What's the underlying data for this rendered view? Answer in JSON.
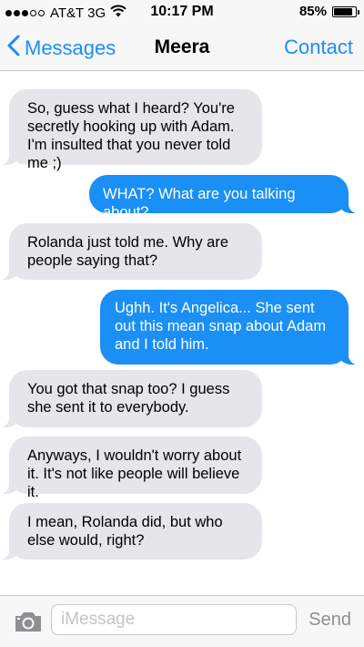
{
  "status_bar": {
    "carrier": "AT&T 3G",
    "time": "10:17 PM",
    "battery": "85%",
    "battery_level": 0.85,
    "signal_bars_filled": 3,
    "signal_bars_total": 5
  },
  "nav": {
    "back_label": "Messages",
    "title": "Meera",
    "contact_label": "Contact"
  },
  "messages": [
    {
      "sender": "them",
      "text": "So, guess what I heard? You're secretly hooking up with Adam. I'm insulted that you never told me ;)"
    },
    {
      "sender": "me",
      "text": "WHAT? What are you talking about?"
    },
    {
      "sender": "them",
      "text": "Rolanda just told me. Why are people saying that?"
    },
    {
      "sender": "me",
      "text": "Ughh. It's Angelica... She sent out this mean snap about Adam and I told him."
    },
    {
      "sender": "them",
      "text": "You got that snap too? I guess she sent it to everybody."
    },
    {
      "sender": "them",
      "text": "Anyways, I wouldn't worry about it. It's not like people will believe it."
    },
    {
      "sender": "them",
      "text": "I mean, Rolanda did, but who else would, right?"
    }
  ],
  "composer": {
    "placeholder": "iMessage",
    "send_label": "Send"
  },
  "icons": {
    "back": "chevron-left-icon",
    "camera": "camera-icon",
    "wifi": "wifi-icon",
    "battery": "battery-icon"
  },
  "colors": {
    "accent": "#1a8ff5",
    "incoming_bubble": "#e5e5ea",
    "outgoing_bubble": "#1a8ff5",
    "bar_background": "#f7f7f7",
    "send_disabled": "#8e8e93"
  }
}
